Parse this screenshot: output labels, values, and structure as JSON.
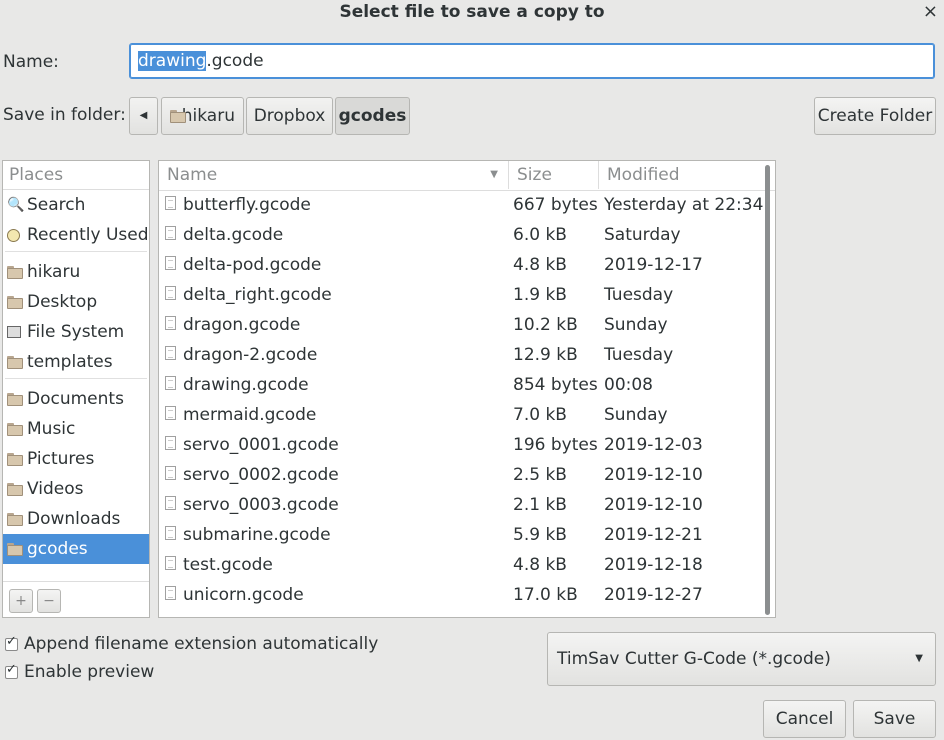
{
  "window": {
    "title": "Select file to save a copy to",
    "close_glyph": "×"
  },
  "name_field": {
    "label": "Name:",
    "selected_part": "drawing",
    "rest": ".gcode"
  },
  "folder_path": {
    "label": "Save in folder:",
    "back_glyph": "◀",
    "segments": [
      "hikaru",
      "Dropbox",
      "gcodes"
    ],
    "create_folder": "Create Folder"
  },
  "places": {
    "header": "Places",
    "items": [
      {
        "label": "Search",
        "icon": "search-icon"
      },
      {
        "label": "Recently Used",
        "icon": "clock-icon"
      },
      {
        "label": "hikaru",
        "icon": "home-folder-icon"
      },
      {
        "label": "Desktop",
        "icon": "desktop-folder-icon"
      },
      {
        "label": "File System",
        "icon": "drive-icon"
      },
      {
        "label": "templates",
        "icon": "folder-icon"
      },
      {
        "label": "Documents",
        "icon": "folder-icon"
      },
      {
        "label": "Music",
        "icon": "music-folder-icon"
      },
      {
        "label": "Pictures",
        "icon": "pictures-folder-icon"
      },
      {
        "label": "Videos",
        "icon": "videos-folder-icon"
      },
      {
        "label": "Downloads",
        "icon": "downloads-folder-icon"
      },
      {
        "label": "gcodes",
        "icon": "folder-icon"
      }
    ],
    "add_glyph": "+",
    "remove_glyph": "−"
  },
  "files": {
    "columns": [
      "Name",
      "Size",
      "Modified"
    ],
    "rows": [
      {
        "name": "butterfly.gcode",
        "size": "667 bytes",
        "modified": "Yesterday at 22:34"
      },
      {
        "name": "delta.gcode",
        "size": "6.0 kB",
        "modified": "Saturday"
      },
      {
        "name": "delta-pod.gcode",
        "size": "4.8 kB",
        "modified": "2019-12-17"
      },
      {
        "name": "delta_right.gcode",
        "size": "1.9 kB",
        "modified": "Tuesday"
      },
      {
        "name": "dragon.gcode",
        "size": "10.2 kB",
        "modified": "Sunday"
      },
      {
        "name": "dragon-2.gcode",
        "size": "12.9 kB",
        "modified": "Tuesday"
      },
      {
        "name": "drawing.gcode",
        "size": "854 bytes",
        "modified": "00:08"
      },
      {
        "name": "mermaid.gcode",
        "size": "7.0 kB",
        "modified": "Sunday"
      },
      {
        "name": "servo_0001.gcode",
        "size": "196 bytes",
        "modified": "2019-12-03"
      },
      {
        "name": "servo_0002.gcode",
        "size": "2.5 kB",
        "modified": "2019-12-10"
      },
      {
        "name": "servo_0003.gcode",
        "size": "2.1 kB",
        "modified": "2019-12-10"
      },
      {
        "name": "submarine.gcode",
        "size": "5.9 kB",
        "modified": "2019-12-21"
      },
      {
        "name": "test.gcode",
        "size": "4.8 kB",
        "modified": "2019-12-18"
      },
      {
        "name": "unicorn.gcode",
        "size": "17.0 kB",
        "modified": "2019-12-27"
      }
    ]
  },
  "options": {
    "append_extension": "Append filename extension automatically",
    "enable_preview": "Enable preview"
  },
  "filter": {
    "selected": "TimSav Cutter G-Code (*.gcode)"
  },
  "buttons": {
    "cancel": "Cancel",
    "save": "Save"
  },
  "colors": {
    "accent": "#4a90d9",
    "background": "#e8e8e7"
  }
}
